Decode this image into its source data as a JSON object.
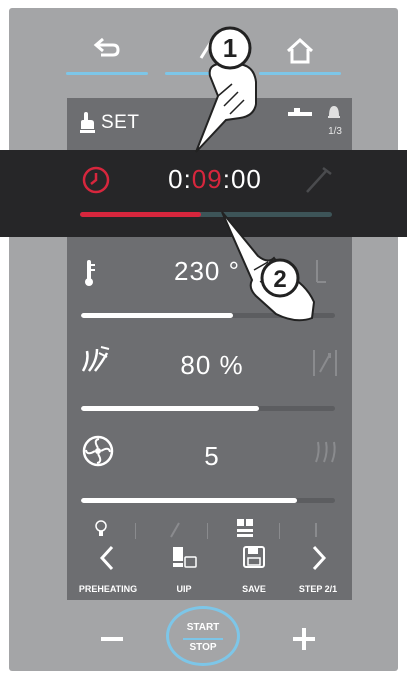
{
  "nav": {
    "back_icon": "back-arrow-icon",
    "home_icon": "home-icon"
  },
  "panel": {
    "set_label": "SET",
    "step_count": "1/3"
  },
  "timer": {
    "hours": "0:",
    "minutes": "09",
    "seconds": ":00",
    "progress": 0.48,
    "progress_color": "#d7263d"
  },
  "temperature": {
    "value": "230 °",
    "progress": 0.6
  },
  "humidity": {
    "value": "80 %",
    "progress": 0.7
  },
  "fan": {
    "value": "5",
    "progress": 0.85
  },
  "bottom": {
    "preheating_label": "PREHEATING",
    "uip_label": "UIP",
    "save_label": "SAVE",
    "step_label": "STEP 2/1"
  },
  "controls": {
    "minus": "−",
    "plus": "+",
    "start": "START",
    "stop": "STOP"
  },
  "annotations": {
    "callout_1": "1",
    "callout_2": "2"
  },
  "colors": {
    "accent": "#7dc6e8",
    "timer_red": "#d7263d",
    "panel": "#6d6e71",
    "device": "#a4a5a7"
  }
}
